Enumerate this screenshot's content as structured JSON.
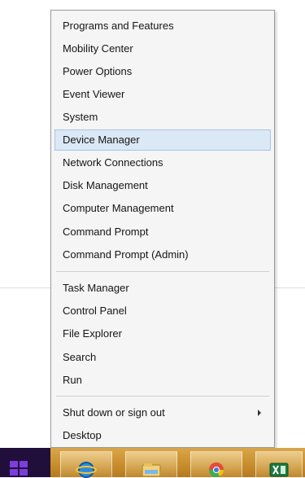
{
  "menu": {
    "items": [
      {
        "label": "Programs and Features"
      },
      {
        "label": "Mobility Center"
      },
      {
        "label": "Power Options"
      },
      {
        "label": "Event Viewer"
      },
      {
        "label": "System"
      },
      {
        "label": "Device Manager",
        "highlighted": true
      },
      {
        "label": "Network Connections"
      },
      {
        "label": "Disk Management"
      },
      {
        "label": "Computer Management"
      },
      {
        "label": "Command Prompt"
      },
      {
        "label": "Command Prompt (Admin)"
      },
      {
        "label": "Task Manager"
      },
      {
        "label": "Control Panel"
      },
      {
        "label": "File Explorer"
      },
      {
        "label": "Search"
      },
      {
        "label": "Run"
      },
      {
        "label": "Shut down or sign out",
        "has_submenu": true
      },
      {
        "label": "Desktop"
      }
    ]
  },
  "taskbar": {
    "pinned_apps": [
      {
        "icon": "internet-explorer-icon"
      },
      {
        "icon": "file-explorer-icon"
      },
      {
        "icon": "chrome-icon"
      },
      {
        "icon": "excel-icon"
      }
    ]
  },
  "colors": {
    "menu_background": "#f5f5f5",
    "highlight_fill": "#dbe8f6",
    "highlight_border": "#a8c4e6",
    "taskbar": "#c98f2e",
    "start_button": "#1f0f3a"
  }
}
